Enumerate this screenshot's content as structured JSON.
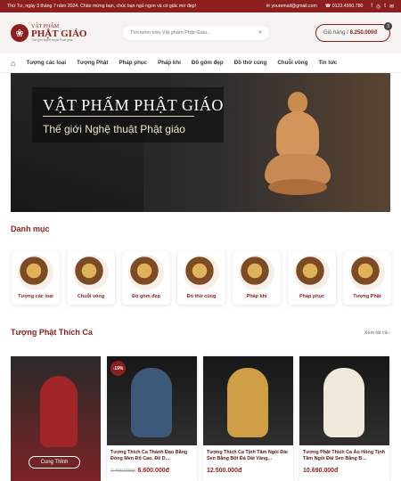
{
  "topbar": {
    "date_notice": "Thứ Tư, ngày 3 tháng 7 năm 2024. Chào mừng bạn, chúc bạn ngủ ngon và có giấc mơ đẹp!",
    "email": "youremail@gmail.com",
    "phone": "0123.4560.780",
    "social": [
      "f",
      "◎",
      "t",
      "✉"
    ]
  },
  "header": {
    "logo_top": "VẬT PHẨM",
    "logo_main": "PHẬT GIÁO",
    "logo_sub": "Thế giới Nghệ thuật Phật giáo",
    "search_placeholder": "Tìm kiếm trên Vật phẩm Phật Giáo...",
    "cart_label": "Giỏ hàng /",
    "cart_amount": "8.250.000đ",
    "cart_count": "3"
  },
  "nav": [
    "Tượng các loại",
    "Tượng Phật",
    "Pháp phục",
    "Pháp khí",
    "Đồ gốm đẹp",
    "Đồ thờ cúng",
    "Chuỗi vòng",
    "Tin tức"
  ],
  "hero": {
    "title": "VẬT PHẨM PHẬT GIÁO",
    "subtitle": "Thế giới Nghệ thuật Phật giáo"
  },
  "categories_title": "Danh mục",
  "categories": [
    "Tượng các loại",
    "Chuỗi vòng",
    "Đồ gốm đẹp",
    "Đồ thờ cúng",
    "Pháp khí",
    "Pháp phục",
    "Tượng Phật"
  ],
  "products_title": "Tượng Phật Thích Ca",
  "see_all": "Xem tất cả",
  "promo_label": "Cung Thỉnh",
  "products": [
    {
      "badge": "-19%",
      "name": "Tượng Thích Ca Thành Đạo Bằng Đồng Men Độ Cao, Để D...",
      "old_price": "7.400.000đ",
      "price": "6.600.000đ"
    },
    {
      "name": "Tượng Thích Ca Tịnh Tâm Ngồi Đài Sen Bằng Bột Đá Dát Vàng...",
      "price": "12.500.000đ"
    },
    {
      "name": "Tượng Phật Thích Ca Áo Hồng Tịnh Tâm Ngồi Đài Sen Bằng B...",
      "price": "10.690.000đ"
    }
  ]
}
